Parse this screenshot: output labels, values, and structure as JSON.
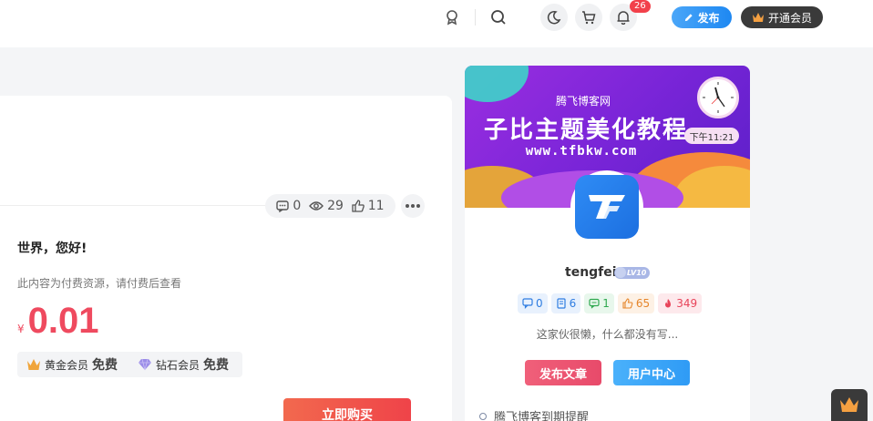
{
  "header": {
    "notification_count": "26",
    "publish_label": "发布",
    "vip_label": "开通会员"
  },
  "post": {
    "stats": {
      "comments": "0",
      "views": "29",
      "likes": "11"
    },
    "title": "世界，您好!",
    "paid_note": "此内容为付费资源，请付费后查看",
    "price_symbol": "¥",
    "price": "0.01",
    "members": [
      {
        "name": "黄金会员",
        "price": "免费"
      },
      {
        "name": "钻石会员",
        "price": "免费"
      }
    ],
    "buy_label": "立即购买"
  },
  "author": {
    "banner_sub": "腾飞博客网",
    "banner_title": "子比主题美化教程",
    "banner_url": "www.tfbkw.com",
    "time": "下午11:21",
    "name": "tengfei",
    "level": "LV10",
    "stats": [
      {
        "icon": "comment-icon",
        "value": "0",
        "bg": "#e8f1fd",
        "color": "#2f7de1"
      },
      {
        "icon": "article-icon",
        "value": "6",
        "bg": "#e8f1fd",
        "color": "#2f7de1"
      },
      {
        "icon": "chat-icon",
        "value": "1",
        "bg": "#e8f7ec",
        "color": "#2fa84f"
      },
      {
        "icon": "like-icon",
        "value": "65",
        "bg": "#fdf1e5",
        "color": "#e6862b"
      },
      {
        "icon": "fire-icon",
        "value": "349",
        "bg": "#fde9ec",
        "color": "#e8445a"
      }
    ],
    "bio": "这家伙很懒，什么都没有写...",
    "publish_article_label": "发布文章",
    "user_center_label": "用户中心",
    "reminder": "腾飞博客到期提醒"
  }
}
